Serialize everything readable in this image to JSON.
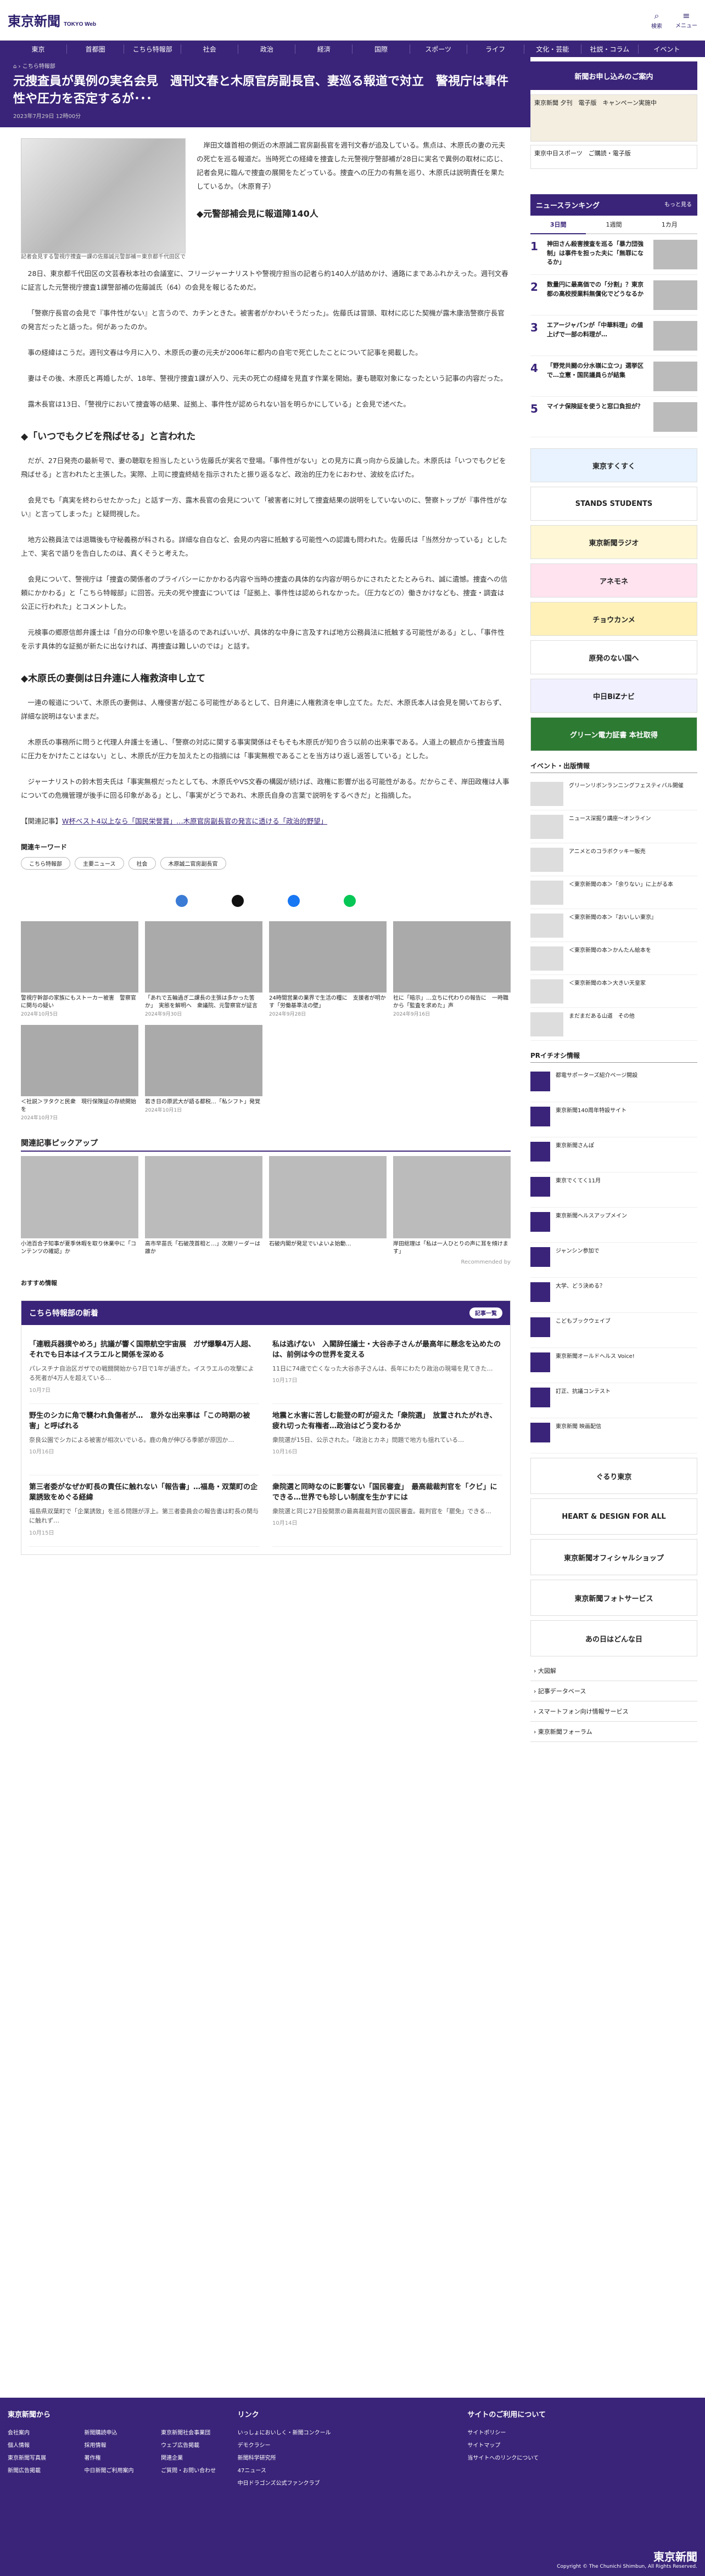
{
  "header": {
    "logo": "東京新聞",
    "logo_sub": "TOKYO Web",
    "search": "検索",
    "menu": "メニュー"
  },
  "nav": [
    "東京",
    "首都圏",
    "こちら特報部",
    "社会",
    "政治",
    "経済",
    "国際",
    "スポーツ",
    "ライフ",
    "文化・芸能",
    "社説・コラム",
    "イベント"
  ],
  "breadcrumb": "こちら特報部",
  "title": "元捜査員が異例の実名会見　週刊文春と木原官房副長官、妻巡る報道で対立　警視庁は事件性や圧力を否定するが･･･",
  "date": "2023年7月29日 12時00分",
  "figure_caption": "記者会見する警視庁捜査一課の佐藤誠元警部補＝東京都千代田区で",
  "paragraphs": [
    "岸田文雄首相の側近の木原誠二官房副長官を週刊文春が追及している。焦点は、木原氏の妻の元夫の死亡を巡る報道だ。当時死亡の経緯を捜査した元警視庁警部補が28日に実名で異例の取材に応じ、記者会見に臨んで捜査の展開をたどっている。捜査への圧力の有無を巡り、木原氏は説明責任を果たしているか。（木原育子）",
    "28日、東京都千代田区の文芸春秋本社の会議室に、フリージャーナリストや警視庁担当の記者ら約140人が詰めかけ、通路にまであふれかえった。週刊文春に証言した元警視庁捜査1課警部補の佐藤誠氏（64）の会見を報じるためだ。",
    "「警察庁長官の会見で『事件性がない』と言うので、カチンときた。被害者がかわいそうだった」。佐藤氏は冒頭、取材に応じた契機が露木康浩警察庁長官の発言だったと語った。何があったのか。",
    "事の経緯はこうだ。週刊文春は今月に入り、木原氏の妻の元夫が2006年に都内の自宅で死亡したことについて記事を掲載した。",
    "妻はその後、木原氏と再婚したが、18年、警視庁捜査1課が入り、元夫の死亡の経緯を見直す作業を開始。妻も聴取対象になったという記事の内容だった。",
    "露木長官は13日、「警視庁において捜査等の結果、証拠上、事件性が認められない旨を明らかにしている」と会見で述べた。",
    "だが、27日発売の最新号で、妻の聴取を担当したという佐藤氏が実名で登場。「事件性がない」との見方に真っ向から反論した。木原氏は「いつでもクビを飛ばせる」と言われたと主張した。実際、上司に捜査終結を指示されたと振り返るなど、政治的圧力をにおわせ、波紋を広げた。",
    "会見でも「真実を終わらせたかった」と話す一方、露木長官の会見について「被害者に対して捜査結果の説明をしていないのに、警察トップが『事件性がない』と言ってしまった」と疑問視した。",
    "地方公務員法では退職後も守秘義務が科される。詳細な自白など、会見の内容に抵触する可能性への認識も問われた。佐藤氏は「当然分かっている」とした上で、実名で語りを告白したのは、真くそうと考えた。",
    "会見について、警視庁は「捜査の関係者のプライバシーにかかわる内容や当時の捜査の具体的な内容が明らかにされたとたとみられ、誠に遺憾。捜査への信頼にかかわる」と「こちら特報部」に回答。元夫の死や捜査については「証拠上、事件性は認められなかった。（圧力などの）働きかけなども、捜査・調査は公正に行われた」とコメントした。",
    "元検事の郷原信郎弁護士は「自分の印象や思いを語るのであればいいが、具体的な中身に言及すれば地方公務員法に抵触する可能性がある」とし、「事件性を示す具体的な証拠が新たに出なければ、再捜査は難しいのでは」と話す。",
    "一連の報道について、木原氏の妻側は、人権侵害が起こる可能性があるとして、日弁連に人権救済を申し立てた。ただ、木原氏本人は会見を開いておらず、詳細な説明はないままだ。",
    "木原氏の事務所に問うと代理人弁護士を通し、「警察の対応に関する事実関係はそもそも木原氏が知り合う以前の出来事である。人道上の観点から捜査当局に圧力をかけたことはない」とし、木原氏が圧力を加えたとの指摘には「事実無根であることを当方はり返し返答している」とした。",
    "ジャーナリストの鈴木哲夫氏は「事実無根だったとしても、木原氏やVS文春の構図が続けば、政権に影響が出る可能性がある。だからこそ、岸田政権は人事についての危機管理が後手に回る印象がある」とし、「事実がどうであれ、木原氏自身の言葉で説明をするべきだ」と指摘した。"
  ],
  "h2_1": "◆元警部補会見に報道陣140人",
  "h2_2": "◆「いつでもクビを飛ばせる」と言われた",
  "h2_3": "◆木原氏の妻側は日弁連に人権救済申し立て",
  "related_label": "【関連記事】",
  "related_link": "W杯ベスト4以上なら「国民栄誉賞」…木原官房副長官の発言に透ける「政治的野望」",
  "keywords_title": "関連キーワード",
  "keywords": [
    "こちら特報部",
    "主要ニュース",
    "社会",
    "木原誠二官房副長官"
  ],
  "cards": [
    {
      "t": "警視庁幹部の家族にもストーカー被害　警察官に関与の疑い",
      "d": "2024年10月5日"
    },
    {
      "t": "「あれで五輪過ぎ二課長の主張は多かった筈か」　実態を解明へ　衆議院、元警察官が証言",
      "d": "2024年9月30日"
    },
    {
      "t": "24時間営業の業界で生活の糧に　支援者が明かす「労働基準法の壁」",
      "d": "2024年9月28日"
    },
    {
      "t": "社に「暗示」…立ちに代わりの報告に　一時職から「監査を求めた」声",
      "d": "2024年9月16日"
    },
    {
      "t": "＜社説＞ヲタクと民衆　現行保険証の存続開始を",
      "d": "2024年10月7日"
    },
    {
      "t": "若き日の原武大が語る都税…「私シフト」発覚",
      "d": "2024年10月1日"
    }
  ],
  "pick_title": "関連記事ピックアップ",
  "picks": [
    "小池百合子知事が夏季休暇を取り休業中に「コンテンツの確認」か",
    "高市早苗氏「石破茂首相と…」次期リーダーは誰か",
    "石破内閣が発足でいよいよ始動…",
    "岸田総理は「私は一人ひとりの声に耳を傾けます」"
  ],
  "recommended_by": "Recommended by",
  "osusume": "おすすめ情報",
  "news_title": "こちら特報部の新着",
  "news_more": "記事一覧",
  "news": [
    {
      "h": "「連戦兵器撲やめろ」抗議が響く国際航空宇宙展　ガザ爆撃4万人超、それでも日本はイスラエルと関係を深める",
      "p": "パレスチナ自治区ガザでの戦闘開始から7日で1年が過ぎた。イスラエルの攻撃による死者が4万人を超えている…",
      "d": "10月7日"
    },
    {
      "h": "私は逃げない　入閣辞任議士・大谷赤子さんが最高年に懸念を込めたのは、前例は今の世界を変える",
      "p": "11日に74歳で亡くなった大谷赤子さんは、長年にわたり政治の現場を見てきた…",
      "d": "10月17日"
    },
    {
      "h": "野生のシカに角で襲われ負傷者が…　意外な出来事は「この時期の被害」と呼ばれる",
      "p": "奈良公園でシカによる被害が相次いでいる。鹿の角が伸びる季節が原因か…",
      "d": "10月16日"
    },
    {
      "h": "地震と水害に苦しむ能登の町が迎えた「衆院選」　放置されたがれき、疲れ切った有権者…政治はどう変わるか",
      "p": "衆院選が15日、公示された。「政治とカネ」問題で地方も揺れている…",
      "d": "10月16日"
    },
    {
      "h": "第三者委がなぜか町長の責任に触れない「報告書」…福島・双葉町の企業誘致をめぐる経緯",
      "p": "福島県双葉町で「企業誘致」を巡る問題が浮上。第三者委員会の報告書は町長の関与に触れず…",
      "d": "10月15日"
    },
    {
      "h": "衆院選と同時なのに影響ない「国民審査」　最高裁裁判官を「クビ」にできる…世界でも珍しい制度を生かすには",
      "p": "衆院選と同じ27日投開票の最高裁裁判官の国民審査。裁判官を「罷免」できる…",
      "d": "10月14日"
    }
  ],
  "side": {
    "banner": "新聞お申し込みのご案内",
    "ad1": "東京新聞 夕刊　電子版　キャンペーン実施中",
    "ad2": "東京中日スポーツ　ご購読・電子版",
    "ranking_title": "ニュースランキング",
    "ranking_more": "もっと見る",
    "tabs": [
      "3日間",
      "1週間",
      "1カ月"
    ],
    "ranks": [
      "神田さん殺害捜査を巡る「暴力団強制」は事件を担った夫に「無罪になるか」",
      "数量円に最高価での「分割」？東京都の高校授業料無償化でどうなるか",
      "エアージャパンが「中華料理」の値上げで一部の料理が…",
      "「野党共闘の分水嶺に立つ」選挙区で…立憲・国民議員らが結集",
      "マイナ保険証を使うと窓口負担が？"
    ],
    "ads": [
      "東京すくすく",
      "STANDS STUDENTS",
      "東京新聞ラジオ",
      "アネモネ",
      "チョウカンメ",
      "原発のない国へ",
      "中日BiZナビ",
      "グリーン電力証書 本社取得"
    ],
    "events_title": "イベント・出版情報",
    "events": [
      "グリーンリボンランニングフェスティバル開催",
      "ニュース深掘り講座〜オンライン",
      "アニメとのコラボクッキー販売",
      "＜東京新聞の本＞「余りない」に上がる本",
      "＜東京新聞の本＞『おいしい東京』",
      "＜東京新聞の本＞かんたん絵本を",
      "＜東京新聞の本＞大きい天皇家",
      "まだまだある山道　その他"
    ],
    "pr_title": "PRイチオシ情報",
    "prs": [
      "都電サポーターズ紹介ページ開設",
      "東京新聞140周年特設サイト",
      "東京新聞さんぽ",
      "東京でくてく11月",
      "東京新聞ヘルスアップメイン",
      "ジャンシン参加で",
      "大学、どう決める？",
      "こどもブックウェイブ",
      "東京新聞オールドヘルス Voice!",
      "訂正、抗議コンテスト",
      "東京新聞 映画配信"
    ],
    "promos": [
      "ぐるり東京",
      "HEART & DESIGN FOR ALL",
      "東京新聞オフィシャルショップ",
      "東京新聞フォトサービス",
      "あの日はどんな日"
    ],
    "links": [
      "大図解",
      "記事データベース",
      "スマートフォン向け情報サービス",
      "東京新聞フォーラム"
    ]
  },
  "footer": {
    "cols": [
      {
        "h": "東京新聞から",
        "items": [
          "会社案内",
          "新聞購読申込",
          "東京新聞社会事業団",
          "個人情報",
          "採用情報",
          "ウェブ広告掲載",
          "東京新聞写真展",
          "著作権",
          "関連企業",
          "新聞広告掲載",
          "中日新聞ご利用案内",
          "ご質問・お問い合わせ"
        ]
      },
      {
        "h": "リンク",
        "items": [
          "いっしょにおいしく・新聞コンクール",
          "デモクラシー",
          "新聞科学研究所",
          "47ニュース",
          "中日ドラゴンズ公式ファンクラブ"
        ]
      },
      {
        "h": "サイトのご利用について",
        "items": [
          "サイトポリシー",
          "サイトマップ",
          "当サイトへのリンクについて"
        ]
      }
    ],
    "copyright": "Copyright © The Chunichi Shimbun, All Rights Reserved."
  }
}
